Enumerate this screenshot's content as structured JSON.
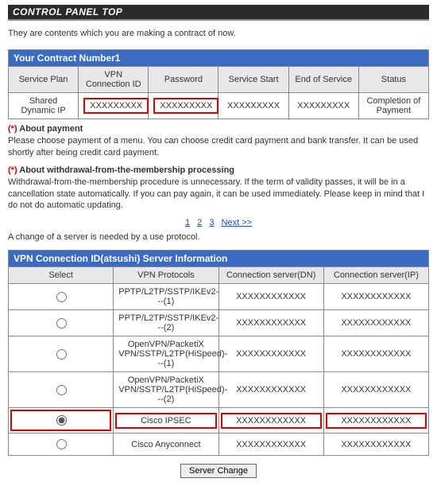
{
  "title": "CONTROL PANEL TOP",
  "intro": "They are contents which you are making a contract of now.",
  "contract": {
    "title": "Your Contract Number1",
    "headers": [
      "Service Plan",
      "VPN Connection ID",
      "Password",
      "Service Start",
      "End of Service",
      "Status"
    ],
    "row": {
      "plan": "Shared Dynamic IP",
      "conn_id": "XXXXXXXXX",
      "password": "XXXXXXXXX",
      "start": "XXXXXXXXX",
      "end": "XXXXXXXXX",
      "status": "Completion of Payment"
    }
  },
  "notes": {
    "payment_title": "About payment",
    "payment_body": "Please choose payment of a menu. You can choose credit card payment and bank transfer. It can be used shortly after being credit card payment.",
    "withdraw_title": "About withdrawal-from-the-membership processing",
    "withdraw_body": "Withdrawal-from-the-membership procedure is unnecessary. If the term of validity passes, it will be in a cancellation state automatically. If you can pay again, it can be used immediately. Please keep in mind that I do not do automatic updating."
  },
  "pager": {
    "p1": "1",
    "p2": "2",
    "p3": "3",
    "next": "Next >>"
  },
  "change_msg": "A change of a server is needed by a use protocol.",
  "server": {
    "title": "VPN Connection ID(atsushi) Server Information",
    "headers": [
      "Select",
      "VPN Protocols",
      "Connection server(DN)",
      "Connection server(IP)"
    ],
    "rows": [
      {
        "sel": false,
        "proto": "PPTP/L2TP/SSTP/IKEv2---(1)",
        "dn": "XXXXXXXXXXXX",
        "ip": "XXXXXXXXXXXX"
      },
      {
        "sel": false,
        "proto": "PPTP/L2TP/SSTP/IKEv2---(2)",
        "dn": "XXXXXXXXXXXX",
        "ip": "XXXXXXXXXXXX"
      },
      {
        "sel": false,
        "proto": "OpenVPN/PacketiX VPN/SSTP/L2TP(HiSpeed)---(1)",
        "dn": "XXXXXXXXXXXX",
        "ip": "XXXXXXXXXXXX"
      },
      {
        "sel": false,
        "proto": "OpenVPN/PacketiX VPN/SSTP/L2TP(HiSpeed)---(2)",
        "dn": "XXXXXXXXXXXX",
        "ip": "XXXXXXXXXXXX"
      },
      {
        "sel": true,
        "proto": "Cisco IPSEC",
        "dn": "XXXXXXXXXXXX",
        "ip": "XXXXXXXXXXXX"
      },
      {
        "sel": false,
        "proto": "Cisco Anyconnect",
        "dn": "XXXXXXXXXXXX",
        "ip": "XXXXXXXXXXXX"
      }
    ]
  },
  "server_change_btn": "Server Change"
}
